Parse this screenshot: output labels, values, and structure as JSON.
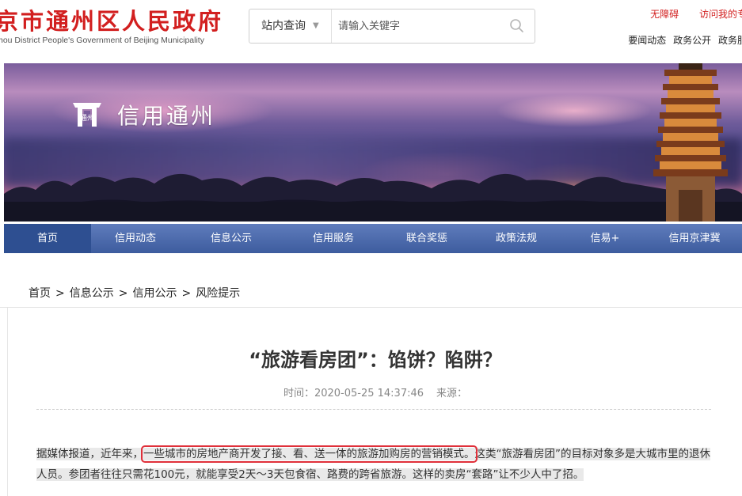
{
  "header": {
    "title": "京市通州区人民政府",
    "subtitle": "hou District People's Government of Beijing Municipality",
    "search": {
      "scope_label": "站内查询",
      "placeholder": "请输入关键字"
    },
    "top_links": [
      "无障碍",
      "访问我的专"
    ],
    "top_nav": [
      "要闻动态",
      "政务公开",
      "政务服"
    ]
  },
  "banner": {
    "logo_text": "通州",
    "title": "信用通州"
  },
  "nav": {
    "items": [
      "首页",
      "信用动态",
      "信息公示",
      "信用服务",
      "联合奖惩",
      "政策法规",
      "信易+",
      "信用京津冀"
    ],
    "active_index": 0
  },
  "breadcrumb": [
    "首页",
    "信息公示",
    "信用公示",
    "风险提示"
  ],
  "article": {
    "title": "“旅游看房团”：馅饼？陷阱？",
    "meta_time_label": "时间：",
    "meta_time_value": "2020-05-25 14:37:46",
    "meta_source_label": "来源：",
    "para_part1": "据媒体报道，近年来，",
    "para_highlight": "一些城市的房地产商开发了接、看、送一体的旅游加购房的营销模式。",
    "para_part2": "这类“旅游看房团”的目标对象多是大城市里的退休人员。参团者往往只需花100元，就能享受2天～3天包食宿、路费的跨省旅游。这样的卖房“套路”让不少人中了招。"
  },
  "colors": {
    "brand_red": "#d21f1f",
    "nav_blue": "#3d5c9e",
    "nav_active": "#2e4f91",
    "highlight_box": "#e0303a"
  },
  "icons": {
    "search": "search-icon",
    "dropdown": "triangle-down-icon",
    "banner_logo": "tongzhou-seal-icon"
  }
}
